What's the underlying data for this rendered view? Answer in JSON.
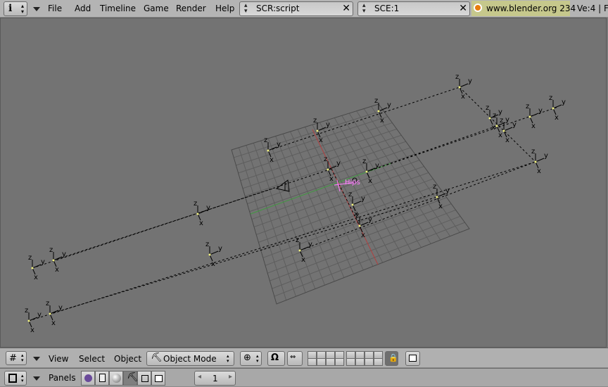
{
  "top_bar": {
    "menus": [
      "File",
      "Add",
      "Timeline",
      "Game",
      "Render",
      "Help"
    ],
    "screen_field": "SCR:script",
    "scene_field": "SCE:1",
    "website": "www.blender.org 234",
    "stats": "Ve:4 | F"
  },
  "viewport_header": {
    "menus": [
      "View",
      "Select",
      "Object"
    ],
    "mode": "Object Mode"
  },
  "buttons_header": {
    "panels_label": "Panels",
    "frame_number": "1"
  },
  "scene_labels": {
    "hips": "Hips"
  },
  "colors": {
    "header_bg": "#b4b4b4",
    "viewport_bg": "#737373",
    "url_bg": "#c6c88c",
    "selection": "#ff80ff"
  }
}
